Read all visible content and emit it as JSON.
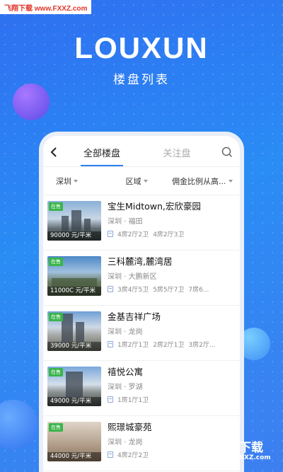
{
  "watermark": "飞翔下载 www.FXXZ.com",
  "brand": {
    "title": "LOUXUN",
    "subtitle": "楼盘列表"
  },
  "header": {
    "tabs": [
      {
        "label": "全部楼盘",
        "active": true
      },
      {
        "label": "关注盘",
        "active": false
      }
    ],
    "back_icon": "chevron-left-icon",
    "search_icon": "search-icon"
  },
  "filters": [
    {
      "label": "深圳"
    },
    {
      "label": "区域"
    },
    {
      "label": "佣金比例从高..."
    }
  ],
  "listings": [
    {
      "name": "宝生Midtown,宏欣豪园",
      "location": "深圳 · 福田",
      "badge": "在售",
      "price": "90000 元/平米",
      "types": [
        "4房2厅2卫",
        "4房2厅3卫"
      ]
    },
    {
      "name": "三科麓湾,麓湾居",
      "location": "深圳 · 大鹏新区",
      "badge": "在售",
      "price": "11000C 元/平米",
      "types": [
        "3房4厅5卫",
        "5房5厅7卫",
        "7房6..."
      ]
    },
    {
      "name": "金基吉祥广场",
      "location": "深圳 · 龙岗",
      "badge": "在售",
      "price": "39000 元/平米",
      "types": [
        "1房2厅1卫",
        "2房2厅1卫",
        "3房2厅..."
      ]
    },
    {
      "name": "禧悦公寓",
      "location": "深圳 · 罗湖",
      "badge": "在售",
      "price": "49000 元/平米",
      "types": [
        "1房1厅1卫"
      ]
    },
    {
      "name": "熙璟城豪苑",
      "location": "深圳 · 龙岗",
      "badge": "在售",
      "price": "44000 元/平米",
      "types": [
        "4房2厅2卫"
      ]
    }
  ],
  "corner_logo": {
    "text": "飞翔下载",
    "url": "www.FXXZ.com"
  },
  "colors": {
    "accent": "#2a7ff0",
    "badge": "#3ab54a",
    "background": "#2f6ff0"
  }
}
